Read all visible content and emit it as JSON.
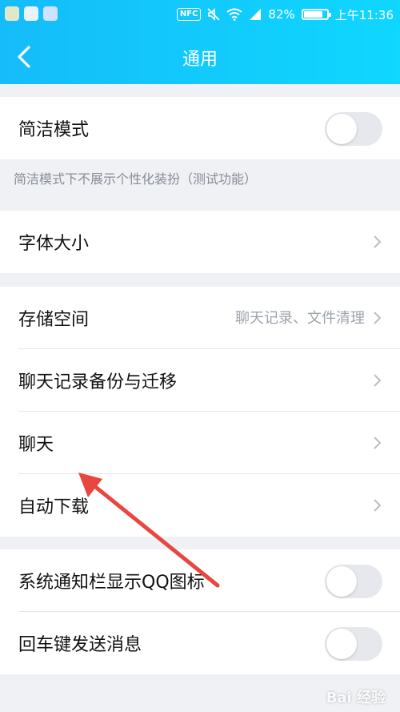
{
  "status_bar": {
    "nfc": "NFC",
    "battery_percent": "82%",
    "battery_level": 0.82,
    "time": "上午11:36"
  },
  "nav": {
    "title": "通用",
    "back_icon": "chevron-left-icon"
  },
  "sections": {
    "concise_mode": {
      "label": "简洁模式",
      "toggle_on": false
    },
    "concise_hint": "简洁模式下不展示个性化装扮（测试功能）",
    "font_size": {
      "label": "字体大小"
    },
    "storage": {
      "label": "存储空间",
      "value": "聊天记录、文件清理"
    },
    "chat_backup": {
      "label": "聊天记录备份与迁移"
    },
    "chat": {
      "label": "聊天"
    },
    "auto_download": {
      "label": "自动下载"
    },
    "notif_icon": {
      "label": "系统通知栏显示QQ图标",
      "toggle_on": false
    },
    "enter_send": {
      "label": "回车键发送消息",
      "toggle_on": false
    }
  },
  "colors": {
    "header_start": "#15bcf9",
    "header_end": "#0fd7ff",
    "annotation_arrow": "#e8463f"
  },
  "watermark": "Bai 经验"
}
